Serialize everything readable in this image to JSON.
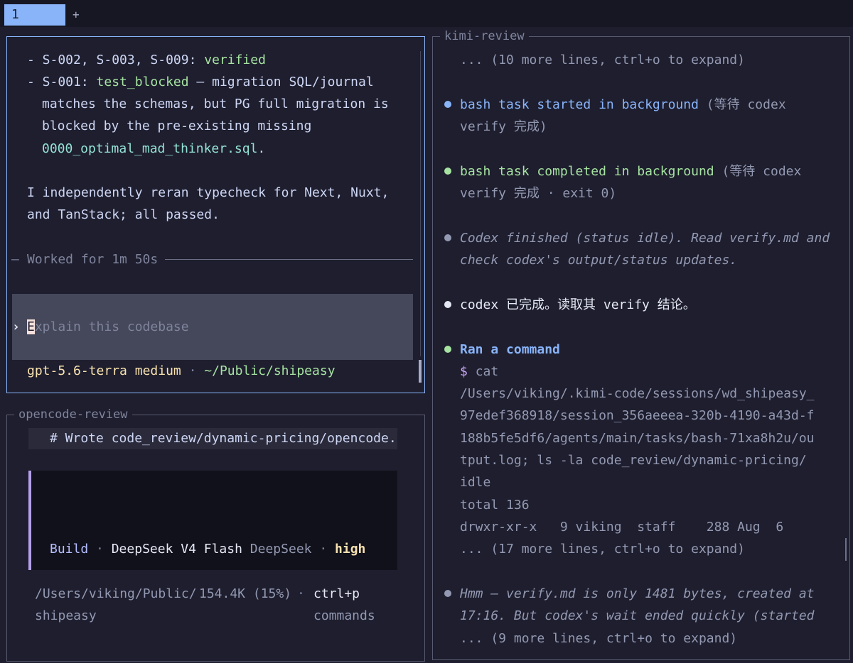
{
  "tabs": {
    "active_label": "1",
    "add_label": "+"
  },
  "codex_pane": {
    "bullets": [
      {
        "prefix": "- S-002, S-003, S-009: ",
        "status": "verified"
      },
      {
        "prefix": "- S-001: ",
        "status": "test_blocked",
        "rest": " — migration SQL/journal"
      }
    ],
    "cont_lines": [
      "matches the schemas, but PG full migration is",
      "blocked by the pre-existing missing"
    ],
    "file_name": "0000_optimal_mad_thinker.sql",
    "file_suffix": ".",
    "summary_lines": [
      "I independently reran typecheck for Next, Nuxt,",
      "and TanStack; all passed."
    ],
    "worked_label": "Worked for 1m 50s",
    "worked_prefix": "—",
    "prompt_marker": "›",
    "input_placeholder_first": "E",
    "input_placeholder_rest": "xplain this codebase",
    "model_name": "gpt-5.6-terra",
    "model_effort": "medium",
    "separator": "·",
    "cwd": "~/Public/shipeasy"
  },
  "opencode_pane": {
    "title": "opencode-review",
    "header_line": "# Wrote code_review/dynamic-pricing/opencode.",
    "mode": "Build",
    "model": "DeepSeek V4 Flash",
    "provider": "DeepSeek",
    "effort": "high",
    "separator": "·",
    "path_line1": "/Users/viking/Public/",
    "path_line2": "shipeasy",
    "tokens": "154.4K (15%)",
    "shortcut_line1": "ctrl+p",
    "shortcut_line2": "commands"
  },
  "kimi_pane": {
    "title": "kimi-review",
    "collapsed_top": "... (10 more lines, ctrl+o to expand)",
    "bash_started": {
      "label": "bash task started in background",
      "note_line1": "(等待 codex",
      "note_line2": "verify 完成)"
    },
    "bash_completed": {
      "label": "bash task completed in background",
      "note_line1": "(等待 codex",
      "note_line2": "verify 完成 · exit 0)"
    },
    "status_note": [
      "Codex finished (status idle). Read verify.md and",
      "check codex's output/status updates."
    ],
    "codex_done": "codex 已完成。读取其 verify 结论。",
    "ran_command": "Ran a command",
    "prompt_symbol": "$",
    "command_lines": [
      "cat",
      "/Users/viking/.kimi-code/sessions/wd_shipeasy_",
      "97edef368918/session_356aeeea-320b-4190-a43d-f",
      "188b5fe5df6/agents/main/tasks/bash-71xa8h2u/ou",
      "tput.log; ls -la code_review/dynamic-pricing/"
    ],
    "output_lines": [
      "idle",
      "total 136",
      "drwxr-xr-x   9 viking  staff    288 Aug  6"
    ],
    "collapsed_mid": "... (17 more lines, ctrl+o to expand)",
    "hmm_lines": [
      "Hmm — verify.md is only 1481 bytes, created at",
      "17:16. But codex's wait ended quickly (started"
    ],
    "collapsed_bottom": "... (9 more lines, ctrl+o to expand)",
    "colors": {
      "dot_blue": "#89b4fa",
      "dot_green": "#a6e3a1",
      "dot_gray": "#9399b2",
      "dot_white": "#e6e9f5"
    }
  }
}
